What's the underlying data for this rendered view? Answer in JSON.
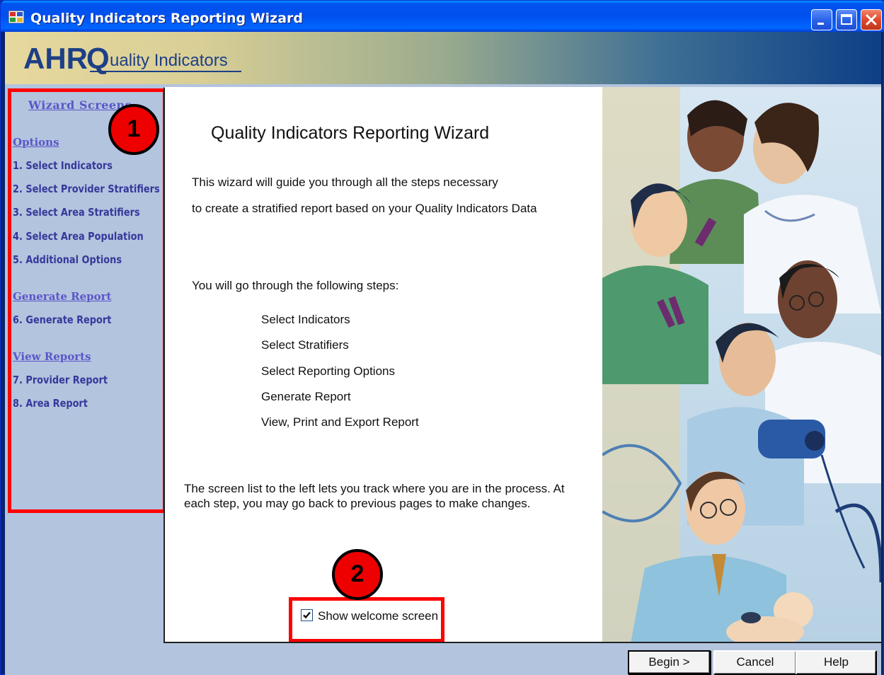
{
  "window": {
    "title": "Quality Indicators Reporting Wizard"
  },
  "banner": {
    "logo_text_ahr": "AHR",
    "logo_text_q": "Q",
    "logo_text_rest": "uality Indicators"
  },
  "nav": {
    "heading": "Wizard Screens",
    "groups": [
      {
        "label": "Options",
        "items": [
          "1. Select Indicators",
          "2. Select Provider Stratifiers",
          "3. Select Area Stratifiers",
          "4. Select Area Population",
          "5. Additional Options"
        ]
      },
      {
        "label": "Generate Report",
        "items": [
          "6. Generate Report"
        ]
      },
      {
        "label": "View Reports",
        "items": [
          "7. Provider Report",
          "8. Area Report"
        ]
      }
    ]
  },
  "main": {
    "title": "Quality Indicators Reporting Wizard",
    "intro_line1": "This wizard will guide you through all the steps necessary",
    "intro_line2": "to create a stratified report based on your Quality Indicators Data",
    "steps_intro": "You will go through the following steps:",
    "steps": [
      "Select Indicators",
      "Select Stratifiers",
      "Select Reporting Options",
      "Generate Report",
      "View, Print and Export Report"
    ],
    "footer_text": "The screen list to the left lets you track where you are in the process.  At each step, you may go back to previous pages to make changes.",
    "show_welcome_label": "Show welcome screen",
    "show_welcome_checked": true
  },
  "buttons": {
    "begin": "Begin >",
    "cancel": "Cancel",
    "help": "Help"
  },
  "annotations": {
    "badge1": "1",
    "badge2": "2"
  },
  "colors": {
    "title_bar": "#0053ee",
    "nav_background": "#b3c4de",
    "nav_link": "#5b56c9",
    "nav_item": "#36389b",
    "annotation_red": "#ff0000"
  }
}
